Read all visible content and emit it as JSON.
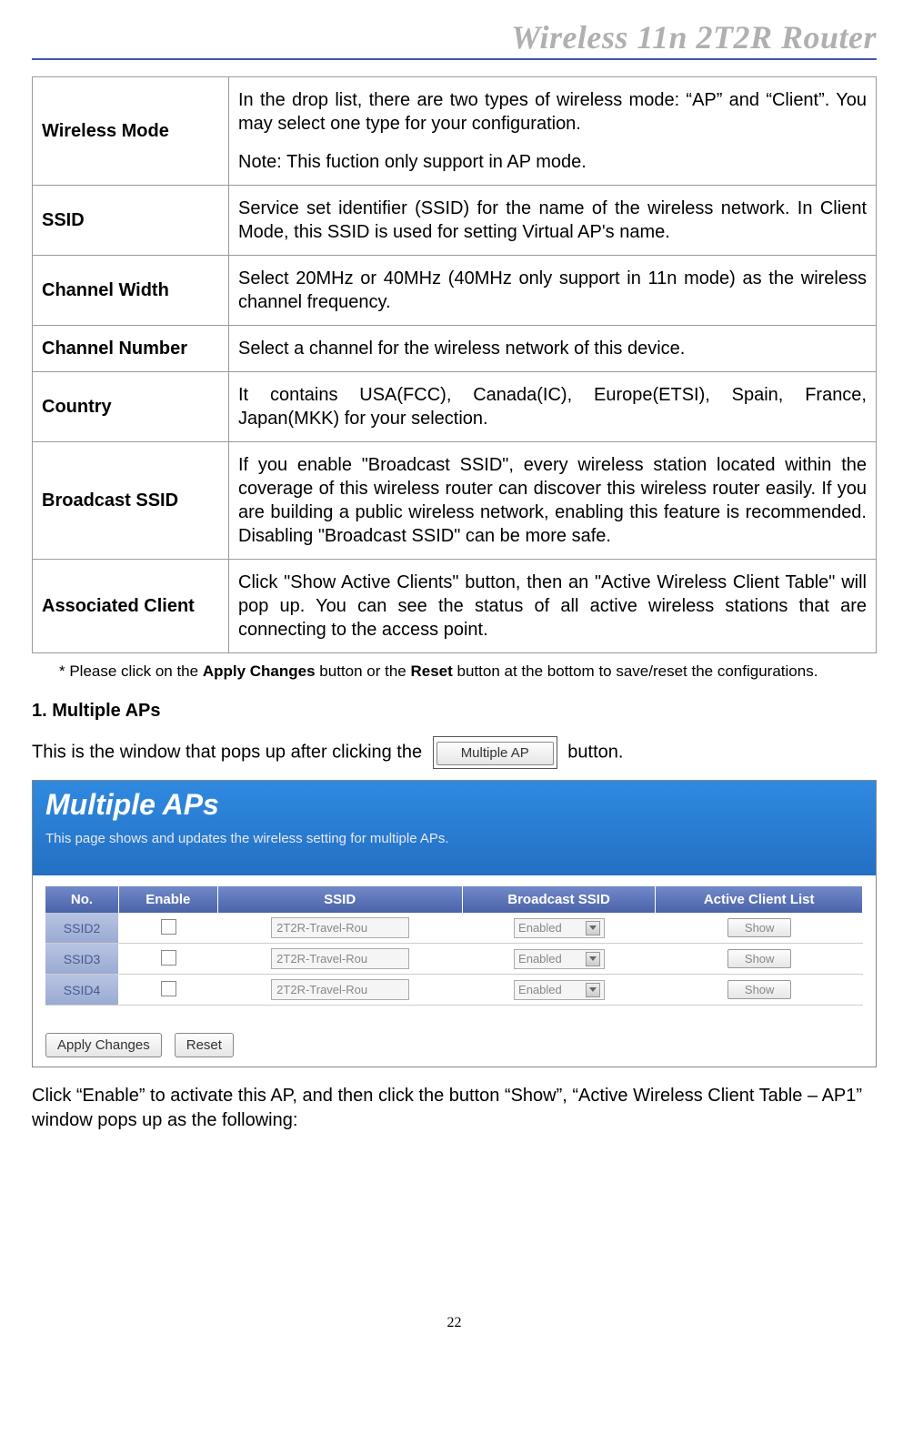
{
  "header": "Wireless 11n 2T2R Router",
  "defs": [
    {
      "key": "Wireless Mode",
      "val": "In the drop list, there are two types of wireless mode: “AP” and “Client”. You may select one type for your configuration.",
      "val2": "Note: This fuction only support in AP mode."
    },
    {
      "key": "SSID",
      "val": "Service set identifier (SSID) for the name of the wireless network. In Client Mode, this SSID is used for setting Virtual AP's name."
    },
    {
      "key": "Channel Width",
      "val": "Select 20MHz or 40MHz (40MHz only support in 11n mode) as the wireless channel frequency."
    },
    {
      "key": "Channel Number",
      "val": "Select a channel for the wireless network of this device."
    },
    {
      "key": "Country",
      "val": "It contains USA(FCC), Canada(IC), Europe(ETSI), Spain, France, Japan(MKK) for your selection."
    },
    {
      "key": "Broadcast SSID",
      "val": "If you enable \"Broadcast SSID\", every wireless station located within the coverage of this wireless router can discover this wireless router easily. If you are building a public wireless network, enabling this feature is recommended. Disabling \"Broadcast SSID\" can be more safe."
    },
    {
      "key": "Associated Client",
      "val": "Click \"Show Active Clients\" button, then an \"Active Wireless Client Table\" will pop up. You can see the status of all active wireless stations that are connecting to the access point."
    }
  ],
  "note": {
    "prefix": "* Please click on the ",
    "b1": "Apply Changes",
    "mid": " button or the ",
    "b2": "Reset",
    "suffix": " button at the bottom to save/reset the configurations."
  },
  "section1": {
    "heading": "1. Multiple APs",
    "line_pre": "This is the window that pops up after clicking the",
    "btn_label": "Multiple AP",
    "line_post": " button."
  },
  "shot": {
    "title": "Multiple APs",
    "sub": "This page shows and updates the wireless setting for multiple APs.",
    "cols": [
      "No.",
      "Enable",
      "SSID",
      "Broadcast SSID",
      "Active Client List"
    ],
    "rows": [
      {
        "no": "SSID2",
        "ssid": "2T2R-Travel-Rou",
        "bc": "Enabled",
        "show": "Show"
      },
      {
        "no": "SSID3",
        "ssid": "2T2R-Travel-Rou",
        "bc": "Enabled",
        "show": "Show"
      },
      {
        "no": "SSID4",
        "ssid": "2T2R-Travel-Rou",
        "bc": "Enabled",
        "show": "Show"
      }
    ],
    "apply": "Apply Changes",
    "reset": "Reset"
  },
  "after_shot": "Click “Enable” to activate this AP, and then click the button “Show”, “Active Wireless Client Table – AP1” window pops up as the following:",
  "page_num": "22"
}
